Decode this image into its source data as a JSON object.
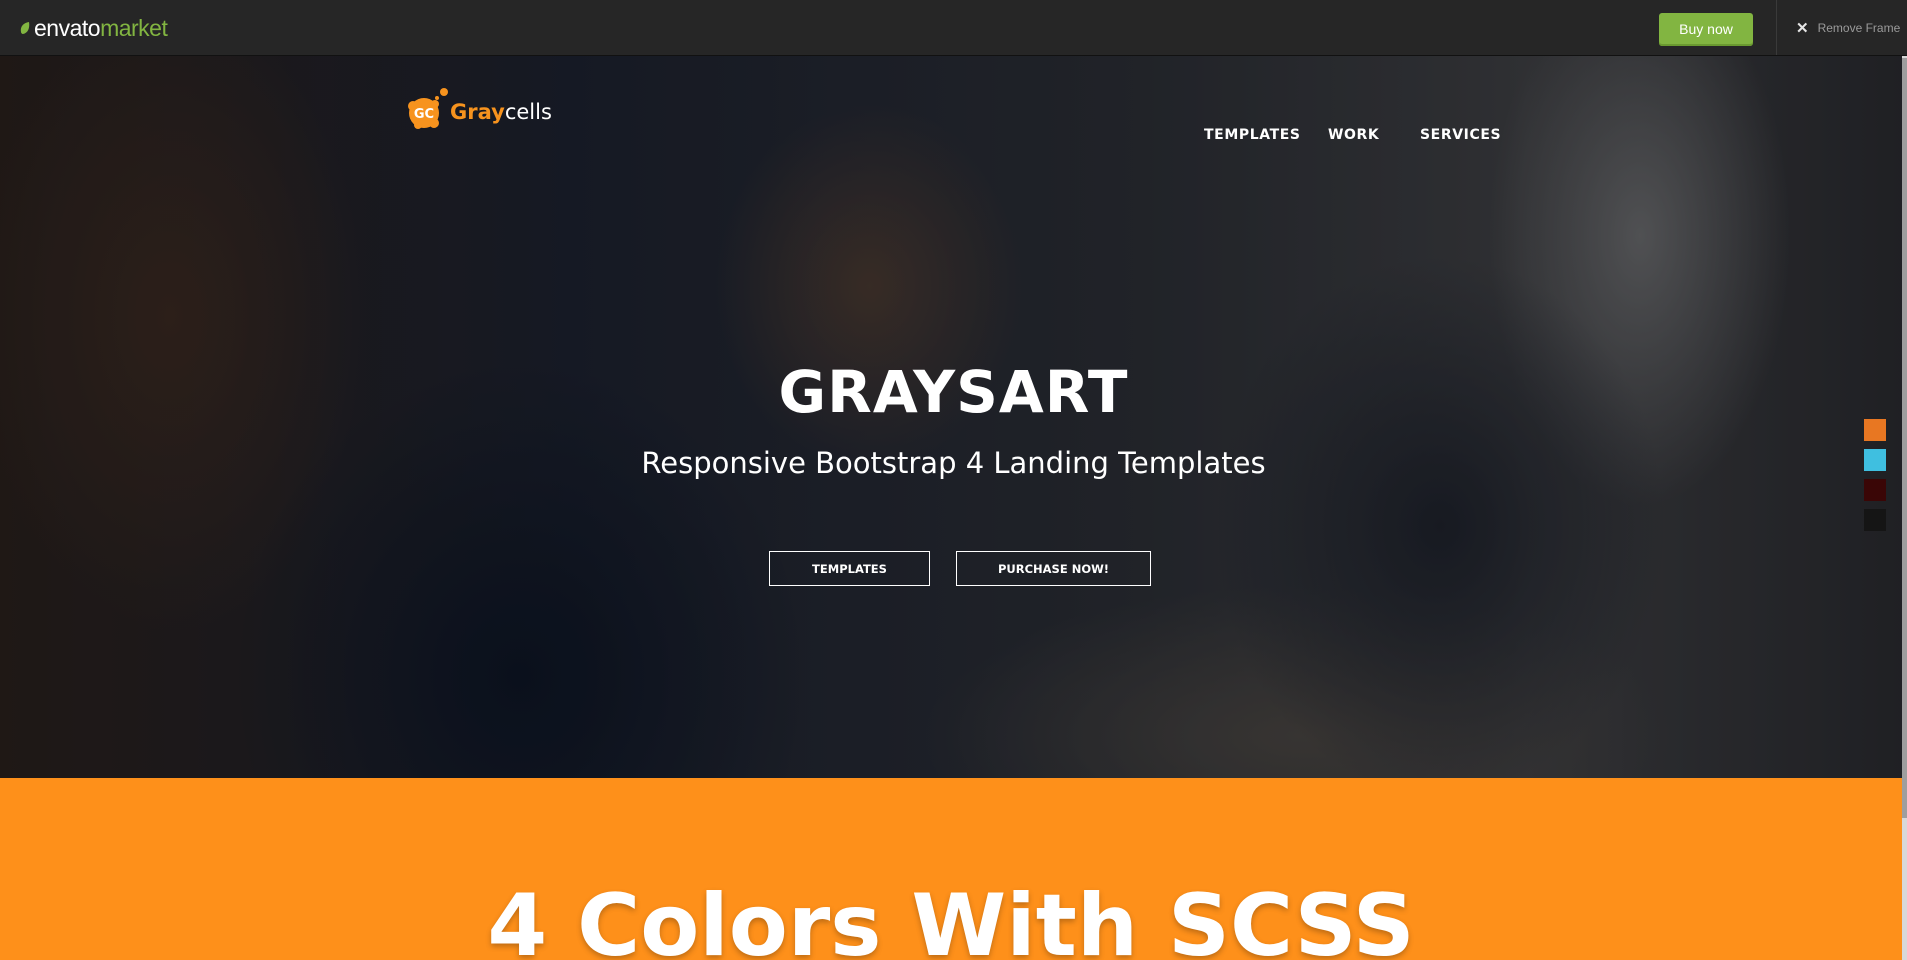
{
  "envato_bar": {
    "logo_part1": "envato",
    "logo_part2": "market",
    "buy_label": "Buy now",
    "remove_frame_label": "Remove Frame",
    "close_glyph": "✕"
  },
  "site": {
    "brand_part1": "Gray",
    "brand_part2": "cells",
    "brand_mark_text": "GC",
    "nav": [
      "TEMPLATES",
      "WORK",
      "SERVICES"
    ]
  },
  "hero": {
    "title": "GRAYSART",
    "subtitle": "Responsive Bootstrap 4 Landing Templates",
    "buttons": [
      "TEMPLATES",
      "PURCHASE NOW!"
    ]
  },
  "color_switcher": {
    "colors": [
      "#e87722",
      "#3fbfe0",
      "#3a0606",
      "#151515"
    ]
  },
  "section": {
    "title": "4 Colors With SCSS"
  },
  "colors": {
    "envato_green": "#82b541",
    "brand_orange": "#f7931e",
    "section_orange": "#fe901a"
  }
}
